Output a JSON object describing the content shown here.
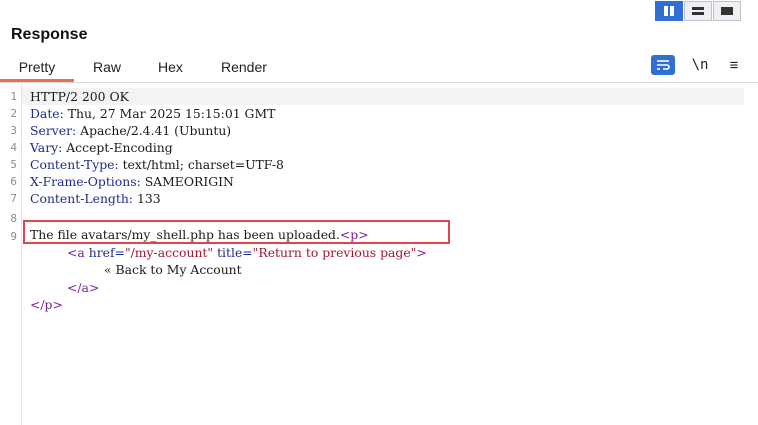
{
  "title": "Response",
  "view_modes": [
    {
      "name": "split-vertical",
      "active": true
    },
    {
      "name": "split-horizontal",
      "active": false
    },
    {
      "name": "single-pane",
      "active": false
    }
  ],
  "tabs": [
    {
      "label": "Pretty",
      "active": true
    },
    {
      "label": "Raw",
      "active": false
    },
    {
      "label": "Hex",
      "active": false
    },
    {
      "label": "Render",
      "active": false
    }
  ],
  "toolbar": {
    "wrap_icon": "word-wrap-icon",
    "newline_label": "\\n",
    "menu_icon": "hamburger-menu-icon"
  },
  "colors": {
    "accent": "#2f6fd3",
    "tab_underline": "#e8704e",
    "highlight_border": "#e0454a"
  },
  "line_numbers": [
    "1",
    "2",
    "3",
    "4",
    "5",
    "6",
    "7",
    "8",
    "9"
  ],
  "lines": {
    "l1": "HTTP/2 200 OK",
    "l2_name": "Date:",
    "l2_value": " Thu, 27 Mar 2025 15:15:01 GMT",
    "l3_name": "Server:",
    "l3_value": " Apache/2.4.41 (Ubuntu)",
    "l4_name": "Vary:",
    "l4_value": " Accept-Encoding",
    "l5_name": "Content-Type:",
    "l5_value": " text/html; charset=UTF-8",
    "l6_name": "X-Frame-Options:",
    "l6_value": " SAMEORIGIN",
    "l7_name": "Content-Length:",
    "l7_value": " 133",
    "l9_text": "The file avatars/my_shell.php has been uploaded.",
    "l9_tag": "<p>",
    "l10_open": "<a",
    "l10_attr1": " href=",
    "l10_val1": "\"/my-account\"",
    "l10_attr2": " title=",
    "l10_val2": "\"Return to previous page\"",
    "l10_close": ">",
    "l11_text": "« Back to My Account",
    "l12_tag": "</a>",
    "l13_tag": "</p>"
  }
}
